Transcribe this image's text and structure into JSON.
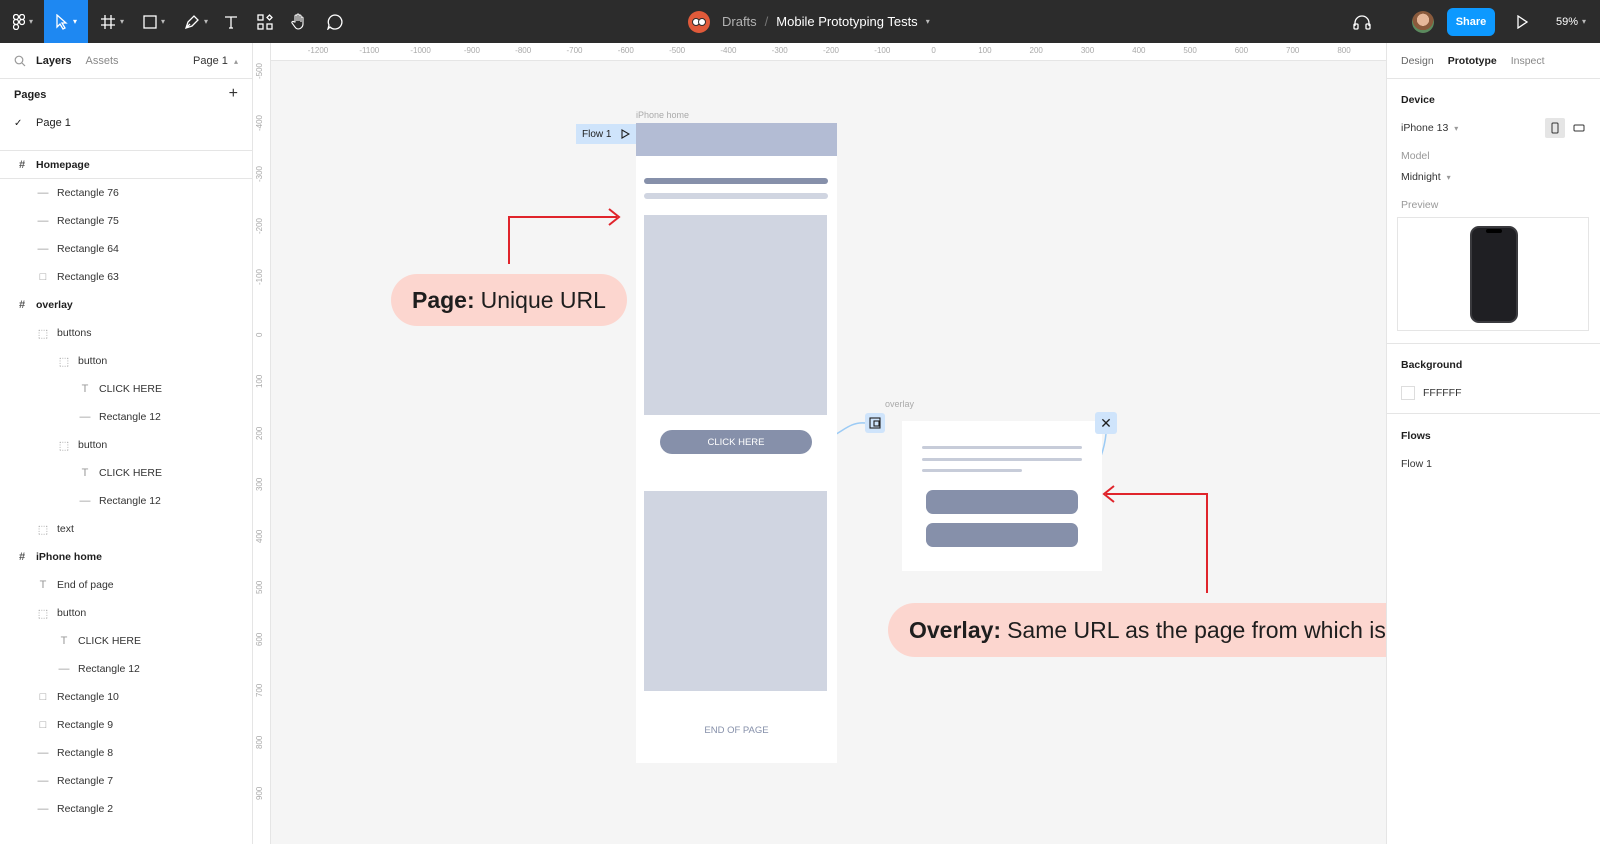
{
  "topbar": {
    "breadcrumb_root": "Drafts",
    "separator": "/",
    "file_name": "Mobile Prototyping Tests",
    "share_label": "Share",
    "zoom": "59%"
  },
  "left_panel": {
    "tabs": [
      "Layers",
      "Assets"
    ],
    "page_select": "Page 1",
    "pages_header": "Pages",
    "current_page": "Page 1",
    "layers": [
      {
        "label": "Homepage",
        "kind": "frame",
        "indent": 0
      },
      {
        "label": "Rectangle 76",
        "kind": "line",
        "indent": 1
      },
      {
        "label": "Rectangle 75",
        "kind": "line",
        "indent": 1
      },
      {
        "label": "Rectangle 64",
        "kind": "line",
        "indent": 1
      },
      {
        "label": "Rectangle 63",
        "kind": "rect",
        "indent": 1
      },
      {
        "label": "overlay",
        "kind": "frame",
        "indent": 0
      },
      {
        "label": "buttons",
        "kind": "group",
        "indent": 1
      },
      {
        "label": "button",
        "kind": "group",
        "indent": 2
      },
      {
        "label": "CLICK HERE",
        "kind": "text",
        "indent": 3
      },
      {
        "label": "Rectangle 12",
        "kind": "line",
        "indent": 3
      },
      {
        "label": "button",
        "kind": "group",
        "indent": 2
      },
      {
        "label": "CLICK HERE",
        "kind": "text",
        "indent": 3
      },
      {
        "label": "Rectangle 12",
        "kind": "line",
        "indent": 3
      },
      {
        "label": "text",
        "kind": "group",
        "indent": 1
      },
      {
        "label": "iPhone home",
        "kind": "frame",
        "indent": 0
      },
      {
        "label": "End of page",
        "kind": "text",
        "indent": 1
      },
      {
        "label": "button",
        "kind": "group",
        "indent": 1
      },
      {
        "label": "CLICK HERE",
        "kind": "text",
        "indent": 2
      },
      {
        "label": "Rectangle 12",
        "kind": "line",
        "indent": 2
      },
      {
        "label": "Rectangle 10",
        "kind": "rect",
        "indent": 1
      },
      {
        "label": "Rectangle 9",
        "kind": "rect",
        "indent": 1
      },
      {
        "label": "Rectangle 8",
        "kind": "line",
        "indent": 1
      },
      {
        "label": "Rectangle 7",
        "kind": "line",
        "indent": 1
      },
      {
        "label": "Rectangle 2",
        "kind": "line",
        "indent": 1
      }
    ]
  },
  "canvas": {
    "ruler_top": [
      "-1200",
      "-1100",
      "-1000",
      "-900",
      "-800",
      "-700",
      "-600",
      "-500",
      "-400",
      "-300",
      "-200",
      "-100",
      "0",
      "100",
      "200",
      "300",
      "400",
      "500",
      "600",
      "700",
      "800"
    ],
    "ruler_left": [
      "-500",
      "-400",
      "-300",
      "-200",
      "-100",
      "0",
      "100",
      "200",
      "300",
      "400",
      "500",
      "600",
      "700",
      "800",
      "900"
    ],
    "iphone_frame_label": "iPhone home",
    "flow_tag": "Flow 1",
    "click_here": "CLICK HERE",
    "end_of_page": "END OF PAGE",
    "overlay_frame_label": "overlay",
    "callout_page_bold": "Page:",
    "callout_page_text": "Unique URL",
    "callout_overlay_bold": "Overlay:",
    "callout_overlay_text": "Same URL as the page from which is triggered",
    "help": "?"
  },
  "right_panel": {
    "tabs": [
      "Design",
      "Prototype",
      "Inspect"
    ],
    "device_header": "Device",
    "device_value": "iPhone 13",
    "model_label": "Model",
    "model_value": "Midnight",
    "preview_label": "Preview",
    "background_header": "Background",
    "background_value": "FFFFFF",
    "flows_header": "Flows",
    "flow_item": "Flow 1"
  },
  "colors": {
    "toolbar_bg": "#2c2c2c",
    "accent_blue": "#0d99ff",
    "callout_bg": "#fcd6cf",
    "arrow_red": "#e0242b",
    "wire_fill": "#d0d5e1",
    "button_fill": "#8690aa"
  }
}
